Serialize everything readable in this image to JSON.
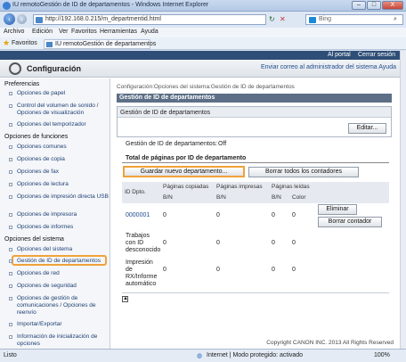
{
  "window": {
    "title": "IU remotoGestión de ID de departamentos - Windows Internet Explorer",
    "min": "–",
    "max": "□",
    "close": "X"
  },
  "address": {
    "url": "http://192.168.0.215/m_departmentid.html",
    "search_placeholder": "Bing"
  },
  "menu": [
    "Archivo",
    "Edición",
    "Ver",
    "Favoritos",
    "Herramientas",
    "Ayuda"
  ],
  "favorites": {
    "label": "Favoritos",
    "tab": "IU remotoGestión de departamentos"
  },
  "page": {
    "header_links": [
      "Al portal",
      "Cerrar sesión"
    ],
    "app_title": "Configuración",
    "top_links": "Enviar correo al administrador del sistema  Ayuda",
    "sidebar": {
      "sections": [
        {
          "title": "Preferencias",
          "items": [
            "Opciones de papel",
            "Control del volumen de sonido / Opciones de visualización",
            "Opciones del temporizador"
          ]
        },
        {
          "title": "Opciones de funciones",
          "items": [
            "Opciones comunes",
            "Opciones de copia",
            "Opciones de fax",
            "Opciones de lectura",
            "Opciones de impresión directa USB",
            "Opciones de impresora",
            "Opciones de informes"
          ]
        },
        {
          "title": "Opciones del sistema",
          "items": [
            "Opciones del sistema",
            "Gestión de ID de departamentos",
            "Opciones de red",
            "Opciones de seguridad",
            "Opciones de gestión de comunicaciones / Opciones de reenvío",
            "Importar/Exportar",
            "Información de inicialización de opciones"
          ]
        }
      ]
    },
    "breadcrumb": "Configuración:Opciones del sistema:Gestión de ID de departamentos",
    "section_title": "Gestión de ID de departamentos",
    "subbox_title": "Gestión de ID de departamentos",
    "edit_button": "Editar...",
    "status_label": "Gestión de ID de departamentos:",
    "status_value": "Off",
    "totals_title": "Total de páginas por ID de departamento",
    "register_button": "Guardar nuevo departamento...",
    "clear_all_button": "Borrar todos los contadores",
    "table": {
      "col_id": "ID Dpto.",
      "groups": [
        "Páginas copiadas",
        "Páginas impresas",
        "Páginas leídas"
      ],
      "sub_copied": "B/N",
      "sub_printed": "B/N",
      "sub_scanned_bw": "B/N",
      "sub_scanned_color": "Color",
      "rows": [
        {
          "id": "0000001",
          "copied": "0",
          "printed": "0",
          "scanned_bw": "0",
          "scanned_color": "0",
          "link": true
        },
        {
          "id": "Trabajos con ID desconocido",
          "copied": "0",
          "printed": "0",
          "scanned_bw": "0",
          "scanned_color": "0",
          "link": false
        },
        {
          "id": "Impresión de RX/Informe automático",
          "copied": "0",
          "printed": "0",
          "scanned_bw": "0",
          "scanned_color": "0",
          "link": false
        }
      ],
      "delete_button": "Eliminar",
      "clear_counter_button": "Borrar contador"
    },
    "copyright": "Copyright CANON INC. 2013 All Rights Reserved"
  },
  "status": {
    "left": "Listo",
    "zone": "Internet | Modo protegido: activado",
    "zoom": "100%"
  },
  "colors": {
    "highlight": "#f0a23b",
    "header": "#2f4e77",
    "section": "#5c6f86"
  }
}
